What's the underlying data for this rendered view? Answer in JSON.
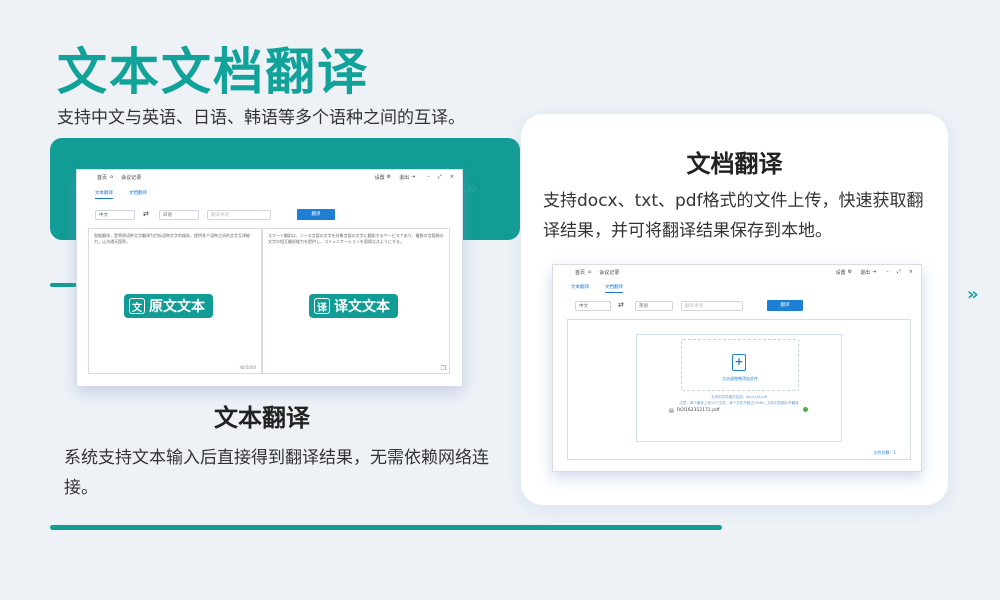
{
  "title": "文本文档翻译",
  "subtitle": "支持中文与英语、日语、韩语等多个语种之间的互译。",
  "chevron": "»",
  "left_mock": {
    "home": "首页",
    "meeting": "会议记录",
    "settings": "设置",
    "exit": "退出",
    "minimize": "–",
    "maximize": "⤢",
    "close": "×",
    "tabs": [
      "文本翻译",
      "文档翻译"
    ],
    "source_lang": "中文",
    "swap": "⇄",
    "target_lang": "日语",
    "domain_placeholder": "翻译术语",
    "translate_btn": "翻译",
    "source_text": "智能翻译，是将原语种文字翻译为目标语种文字的服务，提供多个语种之间的文字互译能力，让沟通无国界。",
    "target_text": "スマート翻訳は、ソース言語の文字を対象言語の文字に翻訳するサービスであり、複数の言語間の文字の相互翻訳能力を提供し、コミュニケーションを国境なきようにする。",
    "char_count": "46/5000",
    "source_badge": "原文文本",
    "source_badge_icon": "文",
    "target_badge": "译文文本",
    "target_badge_icon": "译"
  },
  "card": {
    "heading": "文档翻译",
    "desc": "支持docx、txt、pdf格式的文件上传，快速获取翻译结果，并可将翻译结果保存到本地。"
  },
  "right_mock": {
    "home": "首页",
    "meeting": "会议记录",
    "settings": "设置",
    "exit": "退出",
    "minimize": "–",
    "maximize": "⤢",
    "close": "×",
    "tabs": [
      "文本翻译",
      "文档翻译"
    ],
    "source_lang": "中文",
    "swap": "⇄",
    "target_lang": "英语",
    "domain_placeholder": "翻译术语",
    "translate_btn": "翻译",
    "upload_plus": "+",
    "upload_hint": "点击或拖拽添加文件",
    "format_hint": "支持的文件格式包括：docx,txt,pdf",
    "limit_hint": "注意：单个最多上传10个文件，单个文件不超过10MB，文件中的图片不翻译",
    "file_name": "ROI162312172.pdf",
    "file_count": "文件总数：1"
  },
  "text_heading": "文本翻译",
  "text_desc": "系统支持文本输入后直接得到翻译结果，无需依赖网络连接。"
}
